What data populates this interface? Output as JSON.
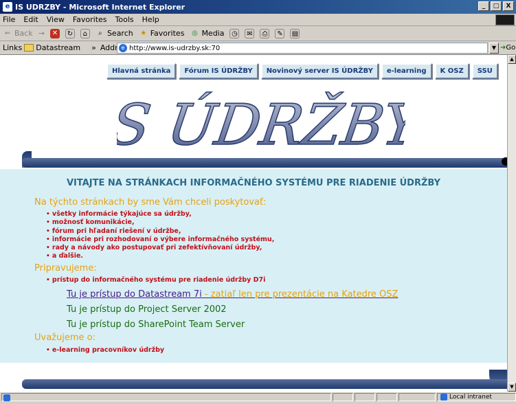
{
  "window": {
    "title": "IS UDRZBY - Microsoft Internet Explorer",
    "icon": "ie-page-icon",
    "buttons": [
      "_",
      "□",
      "X"
    ]
  },
  "menu": [
    "File",
    "Edit",
    "View",
    "Favorites",
    "Tools",
    "Help"
  ],
  "toolbar": {
    "back": "Back",
    "forward": "→",
    "search": "Search",
    "favorites": "Favorites",
    "media": "Media"
  },
  "linksbar": {
    "links_label": "Links",
    "datastream": "Datastream",
    "chevron": "»",
    "address_label": "Address",
    "url": "http://www.is-udrzby.sk:70",
    "go": "Go"
  },
  "nav": [
    "Hlavná stránka",
    "Fórum IS ÚDRŽBY",
    "Novinový server IS ÚDRŽBY",
    "e-learning",
    "K OSZ",
    "SSU"
  ],
  "logo_text": "IS ÚDRŽBY",
  "heading": "VITAJTE NA STRÁNKACH INFORMAČNÉHO SYSTÉMU PRE RIADENIE ÚDRŽBY",
  "intro": "Na týchto stránkach by sme Vám chceli poskytovať:",
  "items": [
    "všetky informácie týkajúce sa údržby,",
    "možnosť komunikácie,",
    "fórum pri hľadaní riešení v údržbe,",
    "informácie pri rozhodovaní o výbere informačného systému,",
    "rady a návody ako postupovať pri zefektívňovaní údržby,",
    "a ďalšie."
  ],
  "preparing_label": "Pripravujeme:",
  "preparing_items": [
    "prístup do informačného systému pre riadenie údržby D7i"
  ],
  "links": {
    "datastream": "Tu je prístup do Datastream 7i",
    "datastream_note": " - zatiaľ len pre prezentácie na Katedre OSZ",
    "project": "Tu je prístup do Project Server 2002",
    "sharepoint": "Tu je prístup do SharePoint Team Server"
  },
  "considering_label": "Uvažujeme o:",
  "considering_items": [
    "e-learning pracovníkov údržby"
  ],
  "status": {
    "zone": "Local intranet"
  },
  "colors": {
    "content_bg": "#d8f0f5",
    "heading": "#2a6a8a",
    "section": "#e8a010",
    "bullets": "#c0101a",
    "links": "#1a6a10",
    "band": "#1e3a6e"
  }
}
